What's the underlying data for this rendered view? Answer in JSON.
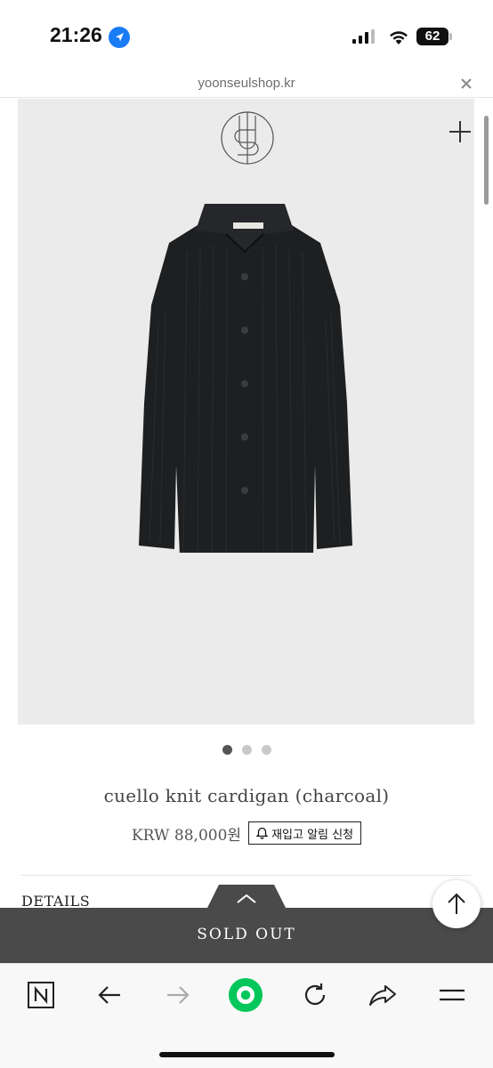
{
  "status_bar": {
    "time": "21:26",
    "battery": "62",
    "icons": [
      "location-arrow-icon",
      "signal-icon",
      "wifi-icon",
      "battery-icon"
    ]
  },
  "url_bar": {
    "url": "yoonseulshop.kr",
    "close_icon": "close-icon"
  },
  "product": {
    "image_alt_icon": "cardigan-image",
    "carousel_count": 3,
    "carousel_active_index": 0,
    "title": "cuello knit cardigan (charcoal)",
    "price": "KRW 88,000원",
    "restock_label": "재입고 알림 신청"
  },
  "details": {
    "label": "DETAILS"
  },
  "soldout": {
    "label": "SOLD OUT"
  },
  "toolbar": {
    "items": [
      "naver-n-icon",
      "back-arrow-icon",
      "forward-arrow-icon",
      "green-home-icon",
      "refresh-icon",
      "share-icon",
      "menu-icon"
    ]
  },
  "colors": {
    "soldout_bg": "#4a4a4a",
    "image_bg": "#ebebeb",
    "green_button": "#03c75a",
    "location_blue": "#1a7cf5"
  }
}
